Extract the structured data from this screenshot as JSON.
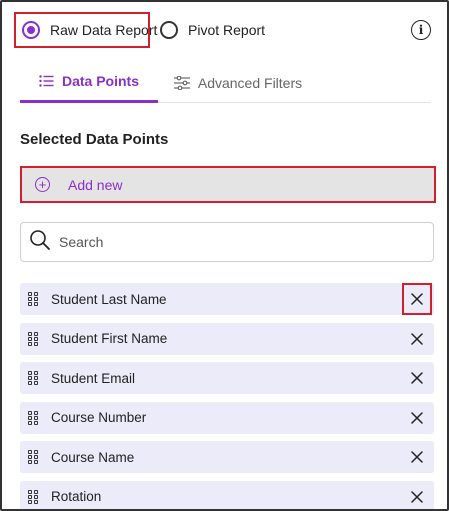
{
  "report_type": {
    "raw_label": "Raw Data Report",
    "pivot_label": "Pivot Report",
    "selected": "raw"
  },
  "tabs": [
    {
      "label": "Data Points",
      "icon": "list-icon",
      "active": true
    },
    {
      "label": "Advanced Filters",
      "icon": "sliders-icon",
      "active": false
    }
  ],
  "section_title": "Selected Data Points",
  "add_new_label": "Add new",
  "search": {
    "placeholder": "Search",
    "value": ""
  },
  "data_points": [
    {
      "label": "Student Last Name"
    },
    {
      "label": "Student First Name"
    },
    {
      "label": "Student Email"
    },
    {
      "label": "Course Number"
    },
    {
      "label": "Course Name"
    },
    {
      "label": "Rotation"
    }
  ],
  "colors": {
    "accent": "#8b2fc9",
    "highlight": "#d0202e",
    "item_bg": "#ecebf9",
    "add_bg": "#e4e4e4"
  }
}
